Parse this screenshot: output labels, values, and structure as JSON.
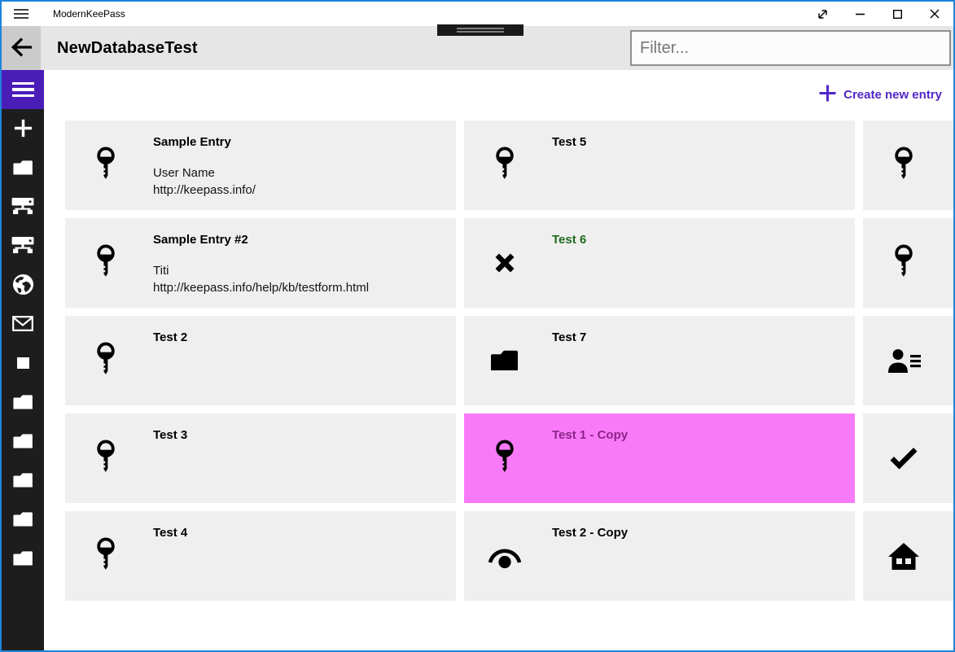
{
  "window": {
    "app_title": "ModernKeePass",
    "titlebar_icons": [
      "menu",
      "fullscreen",
      "minimize",
      "maximize",
      "close"
    ]
  },
  "header": {
    "page_title": "NewDatabaseTest",
    "filter_placeholder": "Filter..."
  },
  "actions": {
    "create_new_entry": "Create new entry"
  },
  "sidebar": {
    "icons": [
      "menu",
      "add",
      "folder",
      "network-drive",
      "network-drive",
      "globe",
      "mail",
      "square",
      "folder",
      "folder",
      "folder",
      "folder",
      "folder"
    ]
  },
  "colors": {
    "accent_purple": "#4b1db8",
    "link_purple": "#5126c9",
    "selected_card_bg": "#f97af9",
    "selected_card_title": "#8b2586",
    "recycled_title_green": "#1c6b1c",
    "card_bg": "#efefef",
    "sidebar_bg": "#1d1d1d",
    "window_border": "#1e85db"
  },
  "entries": [
    {
      "title": "Sample Entry",
      "icon": "key",
      "line1": "User Name",
      "line2": "http://keepass.info/"
    },
    {
      "title": "Sample Entry #2",
      "icon": "key",
      "line1": "Titi",
      "line2": "http://keepass.info/help/kb/testform.html"
    },
    {
      "title": "Test 2",
      "icon": "key"
    },
    {
      "title": "Test 3",
      "icon": "key"
    },
    {
      "title": "Test 4",
      "icon": "key"
    },
    {
      "title": "Test 5",
      "icon": "key"
    },
    {
      "title": "Test 6",
      "icon": "x-cross"
    },
    {
      "title": "Test 7",
      "icon": "folder"
    },
    {
      "title": "Test 1 - Copy",
      "icon": "key",
      "selected": true
    },
    {
      "title": "Test 2 - Copy",
      "icon": "eye"
    },
    {
      "icon": "key"
    },
    {
      "icon": "key"
    },
    {
      "icon": "contact-list"
    },
    {
      "icon": "checkmark"
    },
    {
      "icon": "home"
    }
  ]
}
